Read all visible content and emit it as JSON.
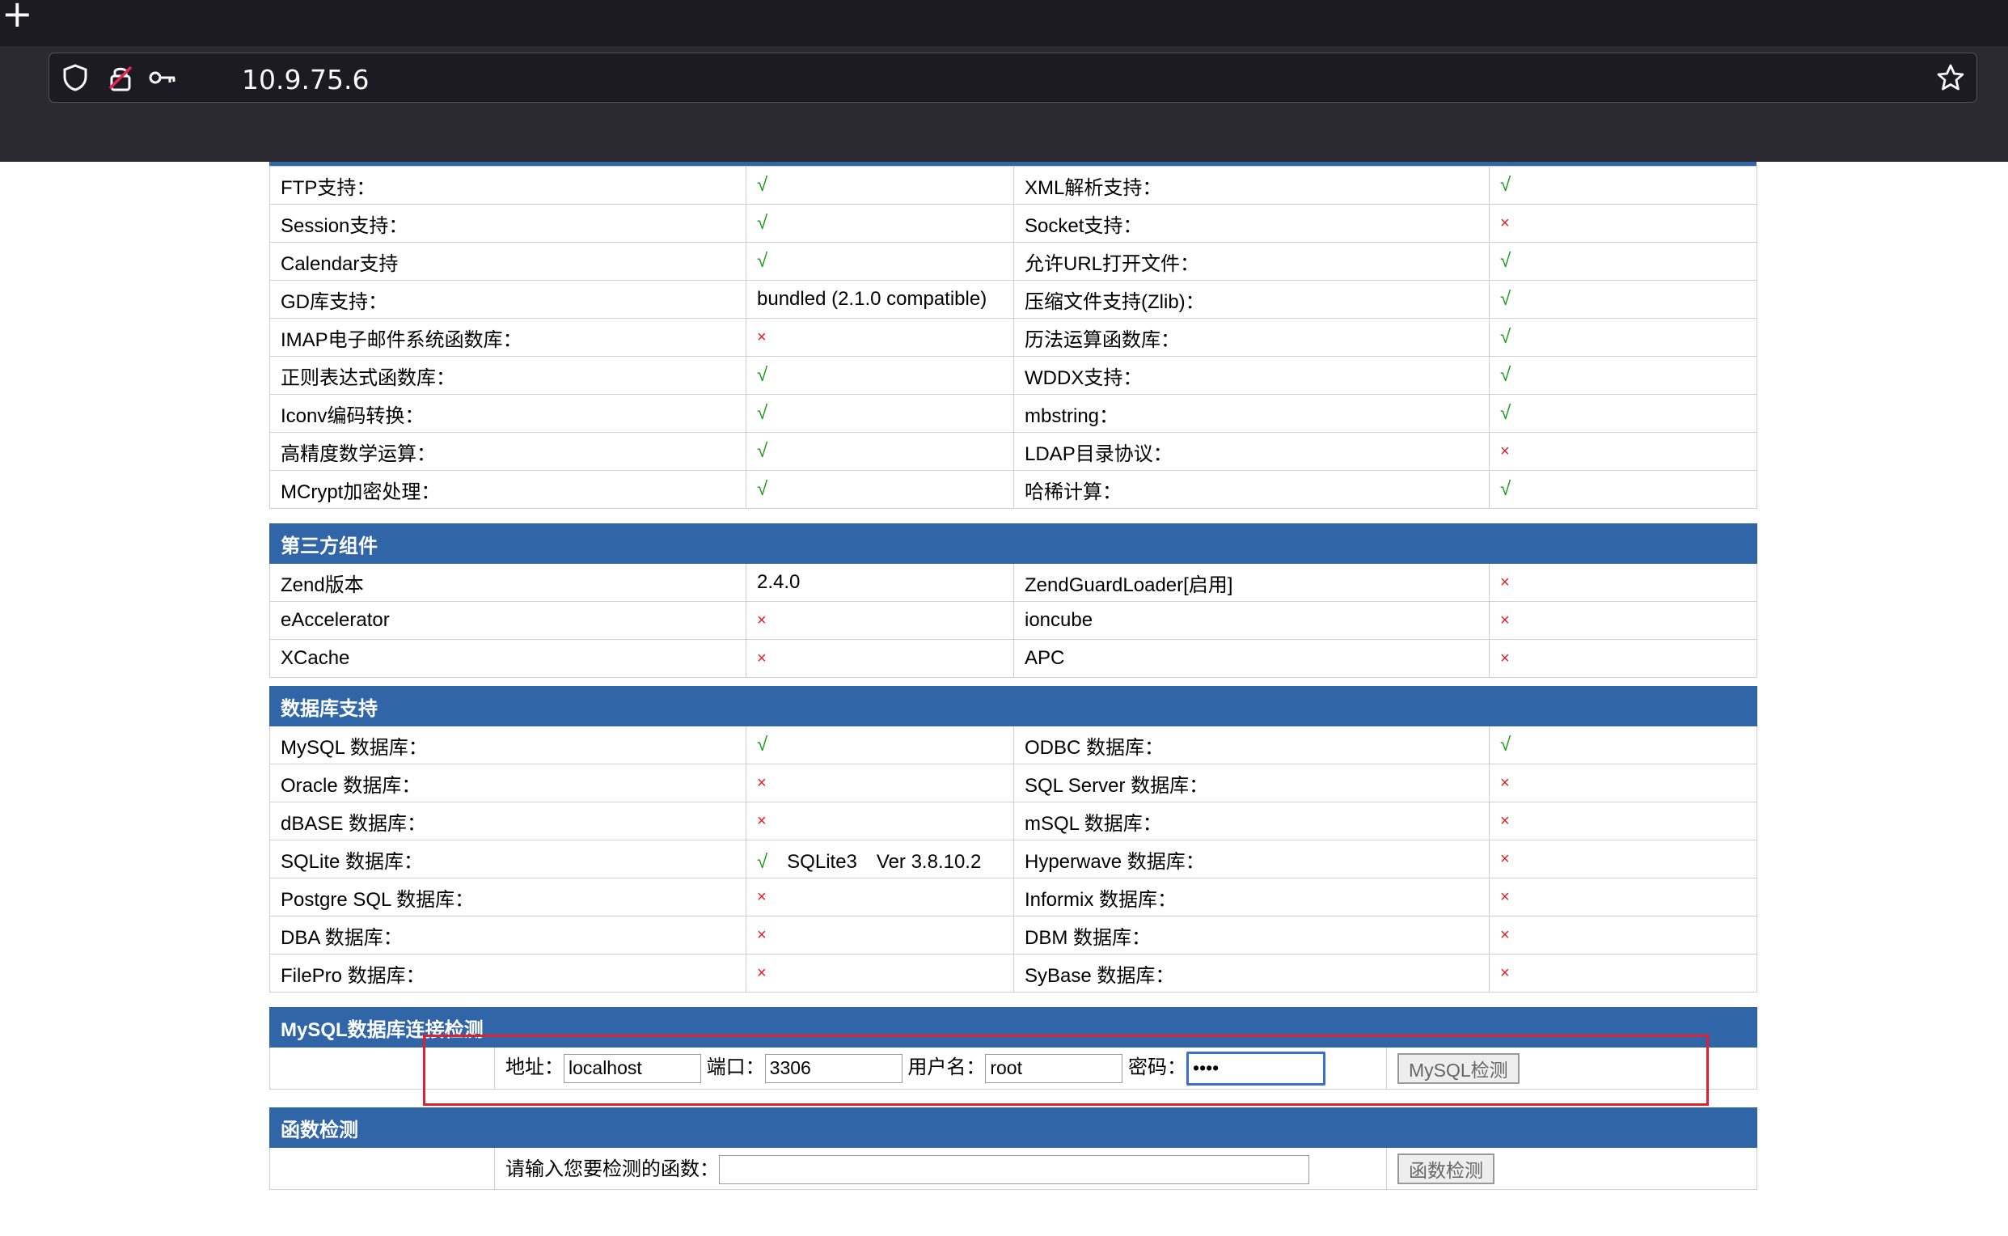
{
  "browser": {
    "new_tab": "+",
    "url": "10.9.75.6",
    "icons": [
      "shield-icon",
      "insecure-lock-icon",
      "key-icon",
      "star-icon"
    ]
  },
  "colors": {
    "header": "#3066a8",
    "check": "#1a9a1a",
    "cross": "#e02020",
    "highlight": "#e02030"
  },
  "ext_rows": [
    [
      "FTP支持：",
      "√",
      "XML解析支持：",
      "√"
    ],
    [
      "Session支持：",
      "√",
      "Socket支持：",
      "×"
    ],
    [
      "Calendar支持",
      "√",
      "允许URL打开文件：",
      "√"
    ],
    [
      "GD库支持：",
      "bundled (2.1.0 compatible)",
      "压缩文件支持(Zlib)：",
      "√"
    ],
    [
      "IMAP电子邮件系统函数库：",
      "×",
      "历法运算函数库：",
      "√"
    ],
    [
      "正则表达式函数库：",
      "√",
      "WDDX支持：",
      "√"
    ],
    [
      "Iconv编码转换：",
      "√",
      "mbstring：",
      "√"
    ],
    [
      "高精度数学运算：",
      "√",
      "LDAP目录协议：",
      "×"
    ],
    [
      "MCrypt加密处理：",
      "√",
      "哈稀计算：",
      "√"
    ]
  ],
  "third_party": {
    "title": "第三方组件",
    "rows": [
      [
        "Zend版本",
        "2.4.0",
        "ZendGuardLoader[启用]",
        "×"
      ],
      [
        "eAccelerator",
        "×",
        "ioncube",
        "×"
      ],
      [
        "XCache",
        "×",
        "APC",
        "×"
      ]
    ]
  },
  "database": {
    "title": "数据库支持",
    "rows": [
      [
        "MySQL 数据库：",
        "√",
        "ODBC 数据库：",
        "√"
      ],
      [
        "Oracle 数据库：",
        "×",
        "SQL Server 数据库：",
        "×"
      ],
      [
        "dBASE 数据库：",
        "×",
        "mSQL 数据库：",
        "×"
      ],
      [
        "SQLite 数据库：",
        "√　SQLite3　Ver 3.8.10.2",
        "Hyperwave 数据库：",
        "×"
      ],
      [
        "Postgre SQL 数据库：",
        "×",
        "Informix 数据库：",
        "×"
      ],
      [
        "DBA 数据库：",
        "×",
        "DBM 数据库：",
        "×"
      ],
      [
        "FilePro 数据库：",
        "×",
        "SyBase 数据库：",
        "×"
      ]
    ]
  },
  "mysql_check": {
    "title": "MySQL数据库连接检测",
    "host_label": "地址：",
    "host_value": "localhost",
    "port_label": "端口：",
    "port_value": "3306",
    "user_label": "用户名：",
    "user_value": "root",
    "pass_label": "密码：",
    "pass_value": "1234",
    "button": "MySQL检测"
  },
  "func_check": {
    "title": "函数检测",
    "prompt": "请输入您要检测的函数：",
    "value": "",
    "button": "函数检测"
  }
}
